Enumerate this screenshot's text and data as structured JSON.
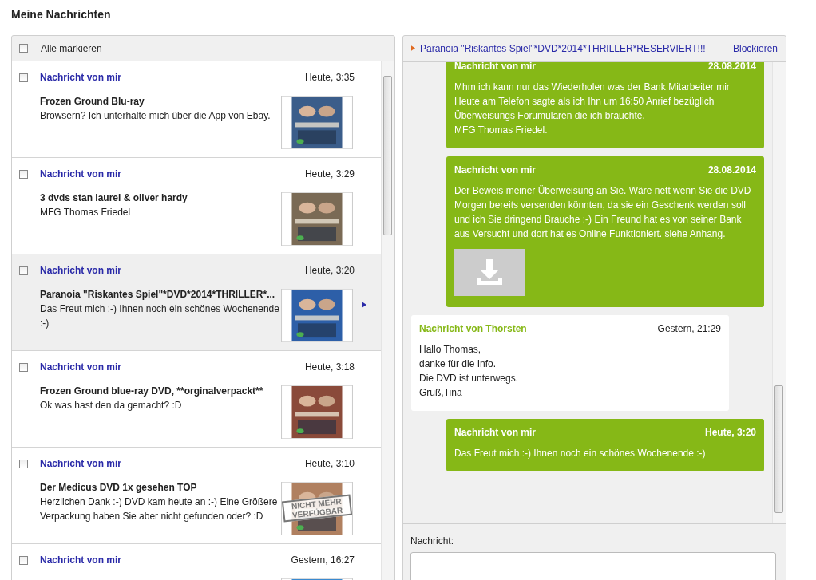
{
  "page_title": "Meine Nachrichten",
  "list": {
    "select_all": {
      "label": "Alle markieren",
      "checked": false
    },
    "rows": [
      {
        "sender": "Nachricht von mir",
        "time": "Heute, 3:35",
        "subject": "Frozen Ground Blu-ray",
        "preview": "Browsern? Ich unterhalte mich über die App von Ebay.",
        "checked": false,
        "selected": false
      },
      {
        "sender": "Nachricht von mir",
        "time": "Heute, 3:29",
        "subject": "3 dvds stan laurel & oliver hardy",
        "preview": "MFG Thomas Friedel",
        "checked": false,
        "selected": false
      },
      {
        "sender": "Nachricht von mir",
        "time": "Heute, 3:20",
        "subject": "Paranoia \"Riskantes Spiel\"*DVD*2014*THRILLER*...",
        "preview": "Das Freut mich :-) Ihnen noch ein schönes Wochenende :-)",
        "checked": false,
        "selected": true
      },
      {
        "sender": "Nachricht von mir",
        "time": "Heute, 3:18",
        "subject": "Frozen Ground blue-ray DVD, **orginalverpackt**",
        "preview": "Ok was hast den da gemacht? :D",
        "checked": false,
        "selected": false
      },
      {
        "sender": "Nachricht von mir",
        "time": "Heute, 3:10",
        "subject": "Der Medicus DVD 1x gesehen TOP",
        "preview": "Herzlichen Dank :-) DVD kam heute an :-) Eine Größere Verpackung haben Sie aber nicht gefunden oder? :D",
        "checked": false,
        "selected": false,
        "stamp": "NICHT MEHR VERFÜGBAR"
      },
      {
        "sender": "Nachricht von mir",
        "time": "Gestern, 16:27",
        "checked": false,
        "selected": false
      }
    ]
  },
  "conversation": {
    "title": "Paranoia \"Riskantes Spiel\"*DVD*2014*THRILLER*RESERVIERT!!!",
    "block_link": "Blockieren",
    "messages": [
      {
        "kind": "own",
        "sender": "Nachricht von mir",
        "time": "28.08.2014",
        "lines": [
          "Mhm ich kann nur das Wiederholen was der Bank Mitarbeiter mir Heute am Telefon sagte als ich Ihn um 16:50 Anrief bezüglich Überweisungs Forumularen die ich brauchte.",
          "MFG Thomas Friedel."
        ]
      },
      {
        "kind": "own",
        "sender": "Nachricht von mir",
        "time": "28.08.2014",
        "lines": [
          "Der Beweis meiner Überweisung an Sie. Wäre nett wenn Sie die DVD Morgen bereits versenden könnten, da sie ein Geschenk werden soll und ich Sie dringend Brauche :-) Ein Freund hat es von seiner Bank aus Versucht und dort hat es Online Funktioniert. siehe Anhang."
        ],
        "attachment": true
      },
      {
        "kind": "other",
        "sender": "Nachricht von Thorsten",
        "time": "Gestern, 21:29",
        "lines": [
          "Hallo Thomas,",
          "danke für die Info.",
          "Die DVD ist unterwegs.",
          "Gruß,Tina"
        ]
      },
      {
        "kind": "own",
        "sender": "Nachricht von mir",
        "time": "Heute, 3:20",
        "lines": [
          "Das Freut mich :-) Ihnen noch ein schönes Wochenende :-)"
        ]
      }
    ]
  },
  "compose": {
    "label": "Nachricht:"
  }
}
